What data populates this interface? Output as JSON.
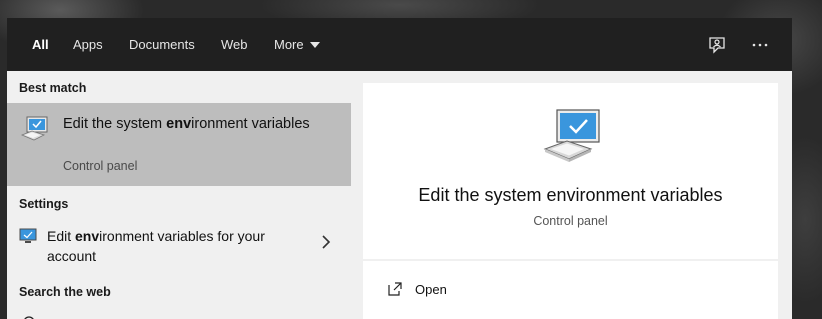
{
  "tabs": [
    {
      "label": "All",
      "active": true
    },
    {
      "label": "Apps"
    },
    {
      "label": "Documents"
    },
    {
      "label": "Web"
    },
    {
      "label": "More"
    }
  ],
  "topbar_icons": [
    "feedback-icon",
    "more-options-icon"
  ],
  "best_match": {
    "heading": "Best match",
    "title_pre": "Edit the system ",
    "title_bold": "env",
    "title_post": "ironment variables",
    "subtitle": "Control panel",
    "icon": "system-properties-icon"
  },
  "settings": {
    "heading": "Settings",
    "item_pre": "Edit ",
    "item_bold": "env",
    "item_post": "ironment variables for your account",
    "icon": "monitor-icon"
  },
  "search_web": {
    "heading": "Search the web",
    "icon": "search-icon"
  },
  "detail": {
    "title": "Edit the system environment variables",
    "subtitle": "Control panel",
    "icon": "system-properties-icon",
    "actions": [
      {
        "label": "Open",
        "icon": "open-icon"
      }
    ]
  },
  "colors": {
    "topbar": "#202020",
    "panel": "#f0f0f0",
    "selected": "#bdbdbd",
    "accent": "#3a96dd"
  }
}
